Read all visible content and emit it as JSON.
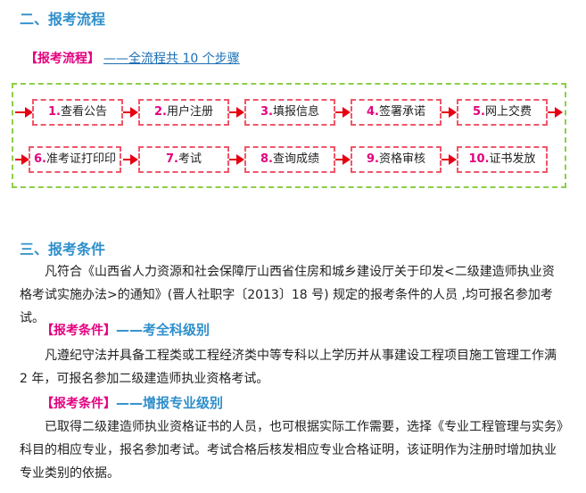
{
  "section2": {
    "title": "二、报考流程",
    "tag": "【报考流程】",
    "link": "——全流程共 10 个步骤"
  },
  "steps": [
    {
      "num": "1.",
      "label": "查看公告"
    },
    {
      "num": "2.",
      "label": "用户注册"
    },
    {
      "num": "3.",
      "label": "填报信息"
    },
    {
      "num": "4.",
      "label": "签署承诺"
    },
    {
      "num": "5.",
      "label": "网上交费"
    },
    {
      "num": "6.",
      "label": "准考证打印印"
    },
    {
      "num": "7.",
      "label": "考试"
    },
    {
      "num": "8.",
      "label": "查询成绩"
    },
    {
      "num": "9.",
      "label": "资格审核"
    },
    {
      "num": "10.",
      "label": "证书发放"
    }
  ],
  "section3": {
    "title": "三、报考条件",
    "intro": "凡符合《山西省人力资源和社会保障厅山西省住房和城乡建设厅关于印发<二级建造师执业资格考试实施办法>的通知》(晋人社职字〔2013〕18 号) 规定的报考条件的人员 ,均可报名参加考试。",
    "sub1_tag": "【报考条件】",
    "sub1_level": "——考全科级别",
    "sub1_text": "凡遵纪守法并具备工程类或工程经济类中等专科以上学历并从事建设工程项目施工管理工作满 2 年，可报名参加二级建造师执业资格考试。",
    "sub2_tag": "【报考条件】",
    "sub2_level": "——增报专业级别",
    "sub2_text": "已取得二级建造师执业资格证书的人员，也可根据实际工作需要，选择《专业工程管理与实务》科目的相应专业，报名参加考试。考试合格后核发相应专业合格证明，该证明作为注册时增加执业专业类别的依据。"
  }
}
